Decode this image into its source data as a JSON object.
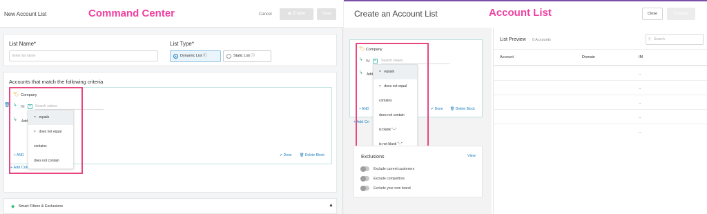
{
  "left": {
    "window_title": "New Account List",
    "annotation": "Command Center",
    "cancel_label": "Cancel",
    "enable_label": "Enable",
    "save_label": "Save",
    "list_name_label": "List Name*",
    "list_name_placeholder": "Enter list name",
    "list_type_label": "List Type*",
    "dynamic_label": "Dynamic List",
    "static_label": "Static List",
    "criteria_title": "Accounts that match the following criteria",
    "company_label": "Company",
    "im_label": "IM",
    "search_placeholder": "Search values",
    "add_label": "Add",
    "and_label": "AND",
    "done_label": "Done",
    "delete_block_label": "Delete Block",
    "add_criteria_label": "Add Criteria",
    "smart_filters_label": "Smart Filters & Exclusions",
    "menu": [
      {
        "mark": "=",
        "label": "equals"
      },
      {
        "mark": "≠",
        "label": "does not equal"
      },
      {
        "mark": "",
        "label": "contains"
      },
      {
        "mark": "",
        "label": "does not contain"
      }
    ]
  },
  "right": {
    "window_title": "Create an Account List",
    "annotation": "Account List",
    "close_label": "Close",
    "continue_label": "Continue",
    "company_label": "Company",
    "im_label": "IM",
    "search_placeholder": "Search values",
    "add_label": "Add",
    "and_label": "AND",
    "add_criteria_label": "Add Cri",
    "done_label": "Done",
    "delete_block_label": "Delete Block",
    "menu": [
      {
        "mark": "=",
        "label": "equals"
      },
      {
        "mark": "≠",
        "label": "does not equal"
      },
      {
        "mark": "",
        "label": "contains"
      },
      {
        "mark": "",
        "label": "does not contain"
      },
      {
        "mark": "",
        "label": "is blank   \"--\""
      },
      {
        "mark": "",
        "label": "is not blank   \"--\""
      }
    ],
    "exclusions_title": "Exclusions",
    "view_label": "View",
    "exclusions": [
      "Exclude current customers",
      "Exclude competitors",
      "Exclude your own brand"
    ],
    "preview_title": "List Preview",
    "preview_count": "0 Accounts",
    "preview_search_placeholder": "Search",
    "columns": [
      "Account",
      "Domain",
      "IM"
    ],
    "rows": [
      "--",
      "--",
      "--",
      "--",
      "--"
    ]
  },
  "colors": {
    "annotation_pink": "#f03fa0",
    "highlight_box": "#e8467f",
    "link_blue": "#1e7fbf",
    "teal": "#3fa8a0"
  }
}
